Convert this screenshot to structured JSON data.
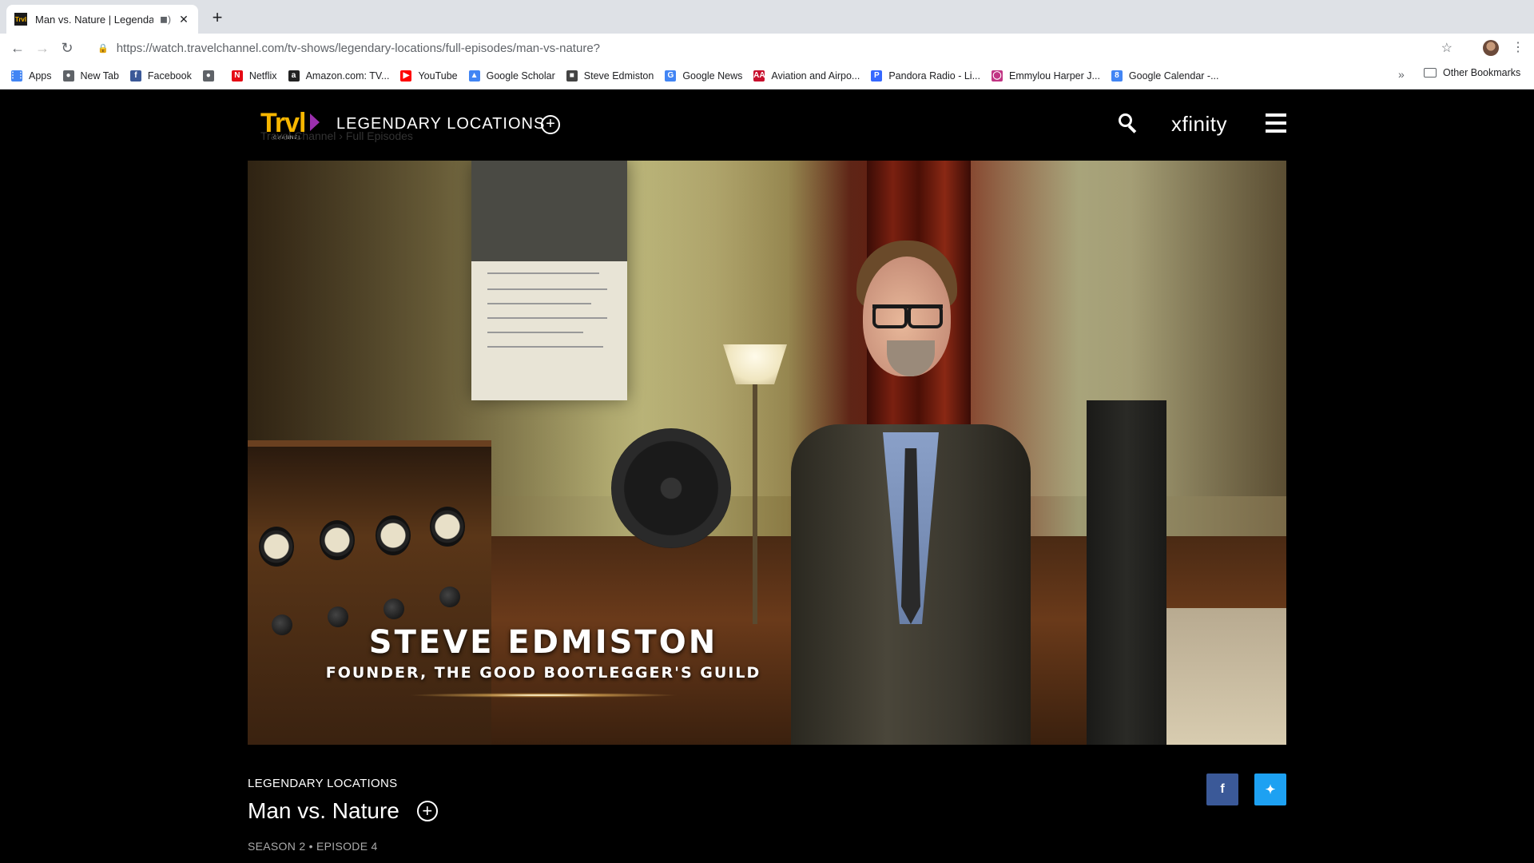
{
  "browser": {
    "tab": {
      "title": "Man vs. Nature | Legendary Locations",
      "favicon": "Trvl"
    },
    "new_tab_symbol": "+",
    "url_host": "https://watch.travelchannel.com",
    "url_path": "/tv-shows/legendary-locations/full-episodes/man-vs-nature?",
    "bookmarks": [
      {
        "label": "Apps",
        "icon": "apps-grid-icon",
        "color": "#4285f4"
      },
      {
        "label": "New Tab",
        "icon": "globe-icon",
        "color": "#5f6368"
      },
      {
        "label": "Facebook",
        "icon": "facebook-icon",
        "color": "#3b5998"
      },
      {
        "label": "",
        "icon": "globe-icon",
        "color": "#5f6368"
      },
      {
        "label": "Netflix",
        "icon": "netflix-icon",
        "color": "#e50914"
      },
      {
        "label": "Amazon.com: TV...",
        "icon": "amazon-icon",
        "color": "#222222"
      },
      {
        "label": "YouTube",
        "icon": "youtube-icon",
        "color": "#ff0000"
      },
      {
        "label": "Google Scholar",
        "icon": "scholar-icon",
        "color": "#4285f4"
      },
      {
        "label": "Steve Edmiston",
        "icon": "cube-icon",
        "color": "#444444"
      },
      {
        "label": "Google News",
        "icon": "google-news-icon",
        "color": "#4285f4"
      },
      {
        "label": "Aviation and Airpo...",
        "icon": "aa-icon",
        "color": "#c8102e"
      },
      {
        "label": "Pandora Radio - Li...",
        "icon": "pandora-icon",
        "color": "#3668ff"
      },
      {
        "label": "Emmylou Harper J...",
        "icon": "instagram-icon",
        "color": "#c13584"
      },
      {
        "label": "Google Calendar -...",
        "icon": "calendar-icon",
        "color": "#4285f4"
      }
    ],
    "more_bookmarks": "»",
    "other_bookmarks": "Other Bookmarks"
  },
  "site": {
    "logo_text": "Trvl",
    "logo_sub": "CHANNEL",
    "show_name": "LEGENDARY LOCATIONS",
    "breadcrumb": "Travel Channel  ›  Full Episodes",
    "partner": "xfinity"
  },
  "video": {
    "lower_third_name": "STEVE EDMISTON",
    "lower_third_role": "FOUNDER, THE GOOD BOOTLEGGER'S GUILD"
  },
  "episode": {
    "show": "LEGENDARY LOCATIONS",
    "title": "Man vs. Nature",
    "season_episode": "SEASON 2 • EPISODE 4"
  },
  "share": {
    "facebook": "f",
    "twitter": "t"
  }
}
